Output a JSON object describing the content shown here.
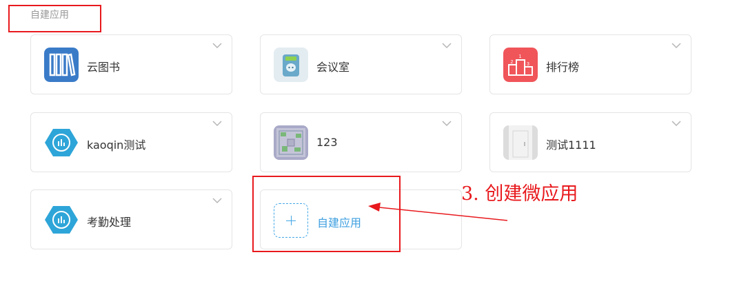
{
  "section": {
    "title": "自建应用"
  },
  "apps": [
    {
      "label": "云图书",
      "icon": "bookshelf-icon"
    },
    {
      "label": "会议室",
      "icon": "meeting-room-icon"
    },
    {
      "label": "排行榜",
      "icon": "podium-icon"
    },
    {
      "label": "kaoqin测试",
      "icon": "attendance-chart-icon"
    },
    {
      "label": "123",
      "icon": "floorplan-thumbnail-icon"
    },
    {
      "label": "测试1111",
      "icon": "door-thumbnail-icon"
    },
    {
      "label": "考勤处理",
      "icon": "attendance-chart-icon"
    }
  ],
  "create": {
    "label": "自建应用",
    "icon": "plus-icon"
  },
  "annotation": {
    "text": "3. 创建微应用"
  },
  "colors": {
    "accent": "#3d9fe0",
    "annotation": "#e8191d",
    "border": "#e4e4e4"
  }
}
